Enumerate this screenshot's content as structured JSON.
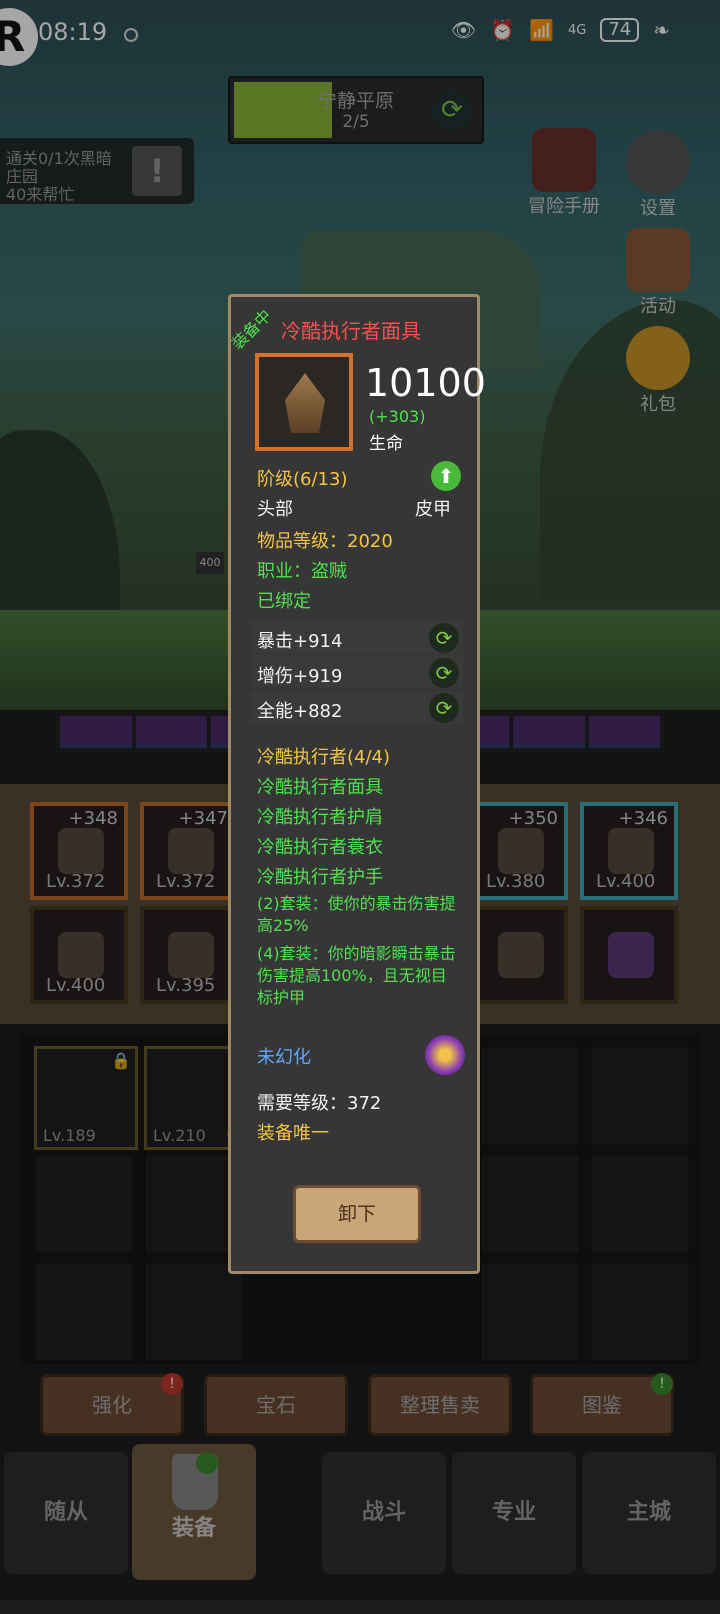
{
  "status_bar": {
    "time": "08:19",
    "battery": "74",
    "network": "4G"
  },
  "logo_letter": "R",
  "stage": {
    "name": "宁静平原",
    "progress": "2/5",
    "fill": 0.4
  },
  "quest": {
    "text": "通关0/1次黑暗庄园",
    "text2": "40来帮忙"
  },
  "side_buttons": [
    {
      "label": "冒险手册",
      "icon": "book-icon"
    },
    {
      "label": "设置",
      "icon": "gear-icon"
    },
    {
      "label": "活动",
      "icon": "scroll-icon"
    },
    {
      "label": "礼包",
      "icon": "coin-icon"
    }
  ],
  "equipment_slots": [
    {
      "level": "Lv.372",
      "plus": "+348",
      "border": "orange"
    },
    {
      "level": "Lv.372",
      "plus": "+347",
      "border": "orange"
    },
    {
      "level": "Lv.380",
      "plus": "+350",
      "border": "blue"
    },
    {
      "level": "Lv.400",
      "plus": "+346",
      "border": "blue"
    },
    {
      "level": "Lv.400",
      "plus": "",
      "border": "gold"
    },
    {
      "level": "Lv.395",
      "plus": "",
      "border": "gold"
    },
    {
      "level": "",
      "plus": "",
      "border": "gold"
    },
    {
      "level": "",
      "plus": "",
      "border": "gold"
    }
  ],
  "bag_items": [
    {
      "level": "Lv.189"
    },
    {
      "level": "Lv.210"
    }
  ],
  "tool_buttons": [
    {
      "label": "强化",
      "badge": "!"
    },
    {
      "label": "宝石",
      "badge": ""
    },
    {
      "label": "整理售卖",
      "badge": ""
    },
    {
      "label": "图鉴",
      "badge": "!"
    }
  ],
  "nav": [
    {
      "label": "随从"
    },
    {
      "label": "装备"
    },
    {
      "label": "战斗"
    },
    {
      "label": "专业"
    },
    {
      "label": "主城"
    }
  ],
  "popup": {
    "equipped_tag": "装备中",
    "item_name": "冷酷执行者面具",
    "power": "10100",
    "power_diff": "(+303)",
    "power_label": "生命",
    "grade": "阶级(6/13)",
    "slot_type": "头部",
    "armor_type": "皮甲",
    "item_level": "物品等级：2020",
    "class": "职业：盗贼",
    "bound": "已绑定",
    "stats": [
      "暴击+914",
      "增伤+919",
      "全能+882"
    ],
    "set_name": "冷酷执行者(4/4)",
    "set_pieces": [
      "冷酷执行者面具",
      "冷酷执行者护肩",
      "冷酷执行者蓑衣",
      "冷酷执行者护手"
    ],
    "set_bonus_2": "(2)套装：使你的暴击伤害提高25%",
    "set_bonus_4": "(4)套装：你的暗影瞬击暴击伤害提高100%，且无视目标护甲",
    "illusion": "未幻化",
    "required_level": "需要等级：372",
    "unique": "装备唯一",
    "unequip_label": "卸下"
  },
  "colors": {
    "item_name": "#ff4d4d",
    "yellow": "#f4c542",
    "green": "#4ee24e",
    "illusion_blue": "#5fa8ff",
    "popup_border": "#a08a64"
  },
  "minimap_numbers": [
    "400"
  ]
}
